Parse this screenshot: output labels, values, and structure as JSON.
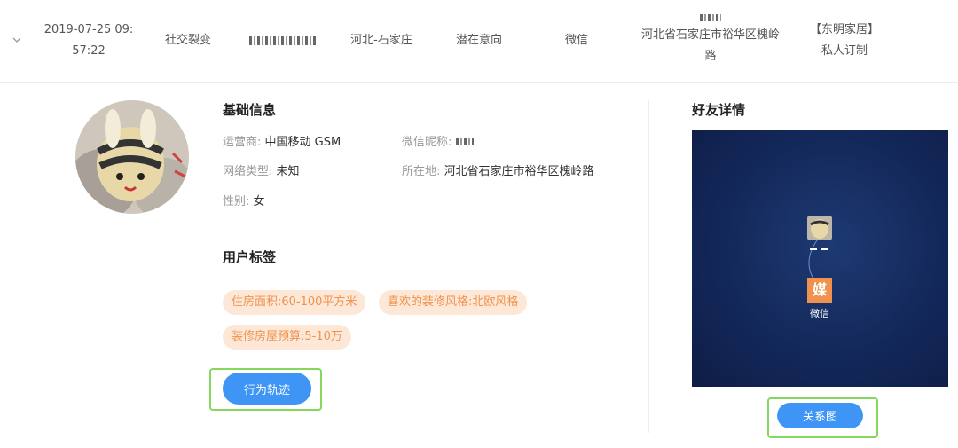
{
  "record_row": {
    "time": "2019-07-25 09:57:22",
    "time_line1": "2019-07-25 09:",
    "time_line2": "57:22",
    "source": "社交裂变",
    "region": "河北-石家庄",
    "intent": "潜在意向",
    "channel": "微信",
    "address_line1": "河北省石家庄市裕华区槐岭",
    "address_line2": "路",
    "project_line1": "【东明家居】",
    "project_line2": "私人订制"
  },
  "basic_info": {
    "title": "基础信息",
    "carrier_label": "运营商:",
    "carrier_value": "中国移动 GSM",
    "wechat_nick_label": "微信昵称:",
    "network_label": "网络类型:",
    "network_value": "未知",
    "location_label": "所在地:",
    "location_value": "河北省石家庄市裕华区槐岭路",
    "gender_label": "性别:",
    "gender_value": "女"
  },
  "user_tags": {
    "title": "用户标签",
    "tags": [
      "住房面积:60-100平方米",
      "喜欢的装修风格:北欧风格",
      "装修房屋预算:5-10万"
    ]
  },
  "buttons": {
    "behavior_track": "行为轨迹",
    "relation_graph": "关系图"
  },
  "friend_details": {
    "title": "好友详情",
    "node_label": "微信",
    "node_icon_text": "媒"
  },
  "colors": {
    "accent": "#3e95f5",
    "tag_bg": "#fde8d7",
    "tag_text": "#f0924e",
    "highlight": "#86d85c",
    "graph_bg": "#13285a",
    "node_orange": "#f0924e"
  }
}
